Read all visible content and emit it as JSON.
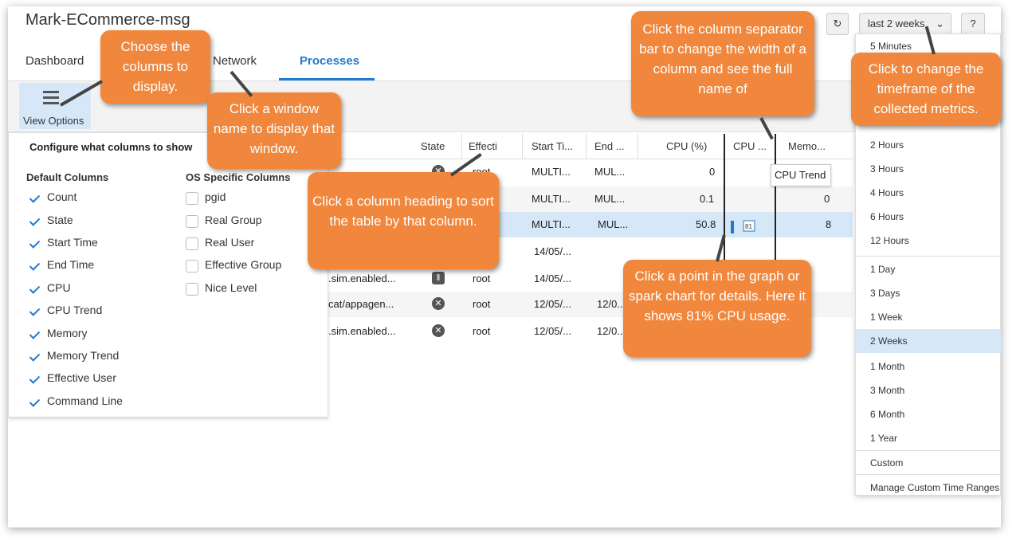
{
  "window": {
    "title": "Mark-ECommerce-msg"
  },
  "tabs": [
    {
      "label": "Dashboard"
    },
    {
      "label": "Network"
    },
    {
      "label": "Processes"
    }
  ],
  "toolbar": {
    "view_options_label": "View Options"
  },
  "timeframe": {
    "selected": "last 2 weeks",
    "help_label": "?"
  },
  "columns_panel": {
    "title": "Configure what columns to show",
    "default_heading": "Default Columns",
    "os_heading": "OS Specific Columns",
    "default_columns": [
      {
        "label": "Count",
        "checked": true
      },
      {
        "label": "State",
        "checked": true
      },
      {
        "label": "Start Time",
        "checked": true
      },
      {
        "label": "End Time",
        "checked": true
      },
      {
        "label": "CPU",
        "checked": true
      },
      {
        "label": "CPU Trend",
        "checked": true
      },
      {
        "label": "Memory",
        "checked": true
      },
      {
        "label": "Memory Trend",
        "checked": true
      },
      {
        "label": "Effective User",
        "checked": true
      },
      {
        "label": "Command Line",
        "checked": true
      }
    ],
    "os_columns": [
      {
        "label": "pgid",
        "checked": false
      },
      {
        "label": "Real Group",
        "checked": false
      },
      {
        "label": "Real User",
        "checked": false
      },
      {
        "label": "Effective Group",
        "checked": false
      },
      {
        "label": "Nice Level",
        "checked": false
      }
    ]
  },
  "table": {
    "headers": {
      "state": "State",
      "effective": "Effecti",
      "start": "Start Ti...",
      "end": "End ...",
      "cpu": "CPU (%)",
      "cpu_trend": "CPU ...",
      "memory": "Memo..."
    },
    "tooltip": "CPU Trend",
    "rows": [
      {
        "cmd": "",
        "state_icon": "x",
        "user": "root",
        "start": "MULTI...",
        "end": "MUL...",
        "cpu": "0",
        "mem": ""
      },
      {
        "cmd": "",
        "state_icon": "",
        "user": "",
        "start": "MULTI...",
        "end": "MUL...",
        "cpu": "0.1",
        "mem": "0"
      },
      {
        "cmd": "",
        "state_icon": "",
        "user": "",
        "start": "MULTI...",
        "end": "MUL...",
        "cpu": "50.8",
        "mem": "8"
      },
      {
        "cmd": "",
        "state_icon": "",
        "user": "",
        "start": "14/05/...",
        "end": "",
        "cpu": "",
        "mem": ""
      },
      {
        "cmd": ".sim.enabled...",
        "state_icon": "pause",
        "user": "root",
        "start": "14/05/...",
        "end": "",
        "cpu": "",
        "mem": ""
      },
      {
        "cmd": "cat/appagen...",
        "state_icon": "x",
        "user": "root",
        "start": "12/05/...",
        "end": "12/0...",
        "cpu": "",
        "mem": ""
      },
      {
        "cmd": ".sim.enabled...",
        "state_icon": "x",
        "user": "root",
        "start": "12/05/...",
        "end": "12/0...",
        "cpu": "",
        "mem": ""
      }
    ],
    "spark_value": "81"
  },
  "timeframe_menu": [
    {
      "label": "5 Minutes"
    },
    {
      "label": "2 Hours"
    },
    {
      "label": "3 Hours"
    },
    {
      "label": "4 Hours"
    },
    {
      "label": "6 Hours"
    },
    {
      "label": "12 Hours"
    },
    {
      "label": "1 Day"
    },
    {
      "label": "3 Days"
    },
    {
      "label": "1 Week"
    },
    {
      "label": "2 Weeks"
    },
    {
      "label": "1 Month"
    },
    {
      "label": "3 Month"
    },
    {
      "label": "6 Month"
    },
    {
      "label": "1 Year"
    },
    {
      "label": "Custom"
    },
    {
      "label": "Manage Custom Time Ranges"
    }
  ],
  "callouts": {
    "columns": "Choose the columns to display.",
    "window": "Click a window name to display that window.",
    "sort": "Click a column heading to sort the table by that column.",
    "separator": "Click the column separator bar to change the width of a column and see the full name of",
    "timeframe": "Click to change the timeframe of the collected metrics.",
    "point": "Click a point in the graph or spark chart for details. Here it shows 81% CPU usage."
  },
  "colors": {
    "accent": "#1f7ad1",
    "callout": "#f0873d",
    "selected_row": "#d6e8f7"
  }
}
